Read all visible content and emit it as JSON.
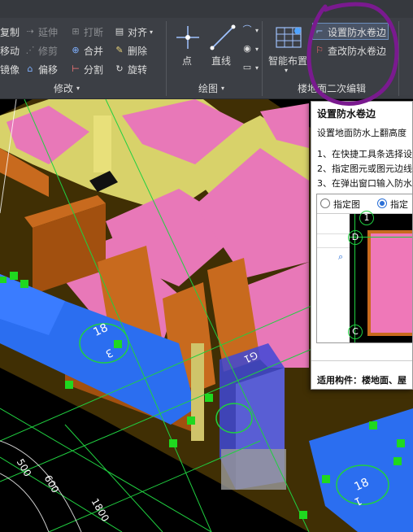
{
  "ribbon": {
    "modify": {
      "copy": "复制",
      "extend": "延伸",
      "break": "打断",
      "align": "对齐",
      "move": "移动",
      "trim": "修剪",
      "merge": "合并",
      "delete": "删除",
      "mirror": "镜像",
      "offset": "偏移",
      "split": "分割",
      "rotate": "旋转",
      "panel_label": "修改"
    },
    "draw": {
      "point": "点",
      "line": "直线",
      "panel_label": "绘图"
    },
    "floor_edit": {
      "smart_layout": "智能布置",
      "set_waterproof_upturn": "设置防水卷边",
      "edit_waterproof_upturn": "查改防水卷边",
      "panel_label": "楼地面二次编辑"
    }
  },
  "tooltip": {
    "title": "设置防水卷边",
    "description": "设置地面防水上翻高度",
    "steps": [
      "1、在快捷工具条选择设",
      "2、指定图元或图元边线",
      "3、在弹出窗口输入防水"
    ],
    "preview": {
      "option_1": "指定图",
      "option_2": "指定",
      "axis_d": "D",
      "axis_c": "C",
      "axis_1": "1"
    },
    "applicable": "适用构件：楼地面、屋"
  },
  "canvas": {
    "axis_labels": [
      "18",
      "3",
      "18",
      "1",
      "G1"
    ],
    "dimensions": [
      "500",
      "600",
      "1800"
    ]
  }
}
